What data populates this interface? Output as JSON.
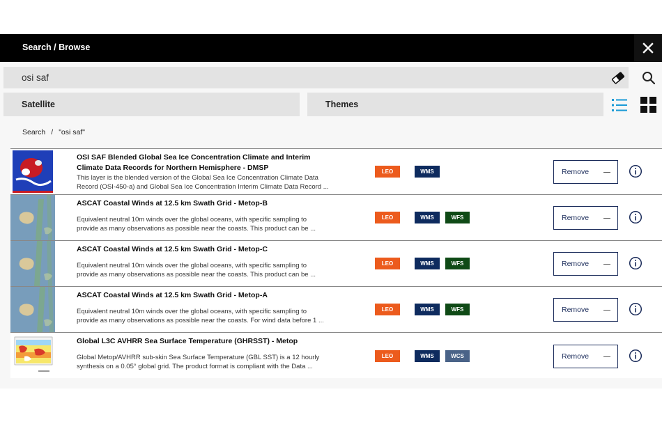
{
  "header": {
    "title": "Search / Browse",
    "close_icon": "close-icon"
  },
  "search": {
    "value": "osi saf",
    "placeholder": "",
    "clear_icon": "eraser-icon",
    "search_icon": "search-icon"
  },
  "tabs": [
    {
      "label": "Satellite"
    },
    {
      "label": "Themes"
    }
  ],
  "view_toggle": {
    "list_icon": "list-view-icon",
    "grid_icon": "grid-view-icon",
    "active": "list",
    "active_color": "#1a9ad6"
  },
  "breadcrumb": {
    "root": "Search",
    "separator": "/",
    "query": "\"osi saf\""
  },
  "results": [
    {
      "title_line1": "OSI SAF Blended Global Sea Ice Concentration Climate and Interim",
      "title_line2": "Climate Data Records for Northern Hemisphere - DMSP",
      "desc_line1": "This layer is the blended version of the Global Sea Ice Concentration Climate Data",
      "desc_line2": "Record (OSI-450-a) and Global Sea Ice Concentration Interim Climate Data Record ...",
      "badges": [
        "LEO",
        "WMS"
      ],
      "remove_label": "Remove",
      "thumb": "sea-ice"
    },
    {
      "title_line1": "ASCAT Coastal Winds at 12.5 km Swath Grid - Metop-B",
      "title_line2": "",
      "desc_line1": "Equivalent neutral 10m winds over the global oceans, with specific sampling to",
      "desc_line2": "provide as many observations as possible near the coasts. This product can be ...",
      "badges": [
        "LEO",
        "WMS",
        "WFS"
      ],
      "remove_label": "Remove",
      "thumb": "winds"
    },
    {
      "title_line1": "ASCAT Coastal Winds at 12.5 km Swath Grid - Metop-C",
      "title_line2": "",
      "desc_line1": "Equivalent neutral 10m winds over the global oceans, with specific sampling to",
      "desc_line2": "provide as many observations as possible near the coasts. This product can be ...",
      "badges": [
        "LEO",
        "WMS",
        "WFS"
      ],
      "remove_label": "Remove",
      "thumb": "winds"
    },
    {
      "title_line1": "ASCAT Coastal Winds at 12.5 km Swath Grid - Metop-A",
      "title_line2": "",
      "desc_line1": "Equivalent neutral 10m winds over the global oceans, with specific sampling to",
      "desc_line2": "provide as many observations as possible near the coasts. For wind data before 1 ...",
      "badges": [
        "LEO",
        "WMS",
        "WFS"
      ],
      "remove_label": "Remove",
      "thumb": "winds"
    },
    {
      "title_line1": "Global L3C AVHRR Sea Surface Temperature (GHRSST) - Metop",
      "title_line2": "",
      "desc_line1": "Global Metop/AVHRR sub-skin Sea Surface Temperature (GBL SST) is a 12 hourly",
      "desc_line2": "synthesis on a 0.05° global grid. The product format is compliant with the Data ...",
      "badges": [
        "LEO",
        "WMS",
        "WCS"
      ],
      "remove_label": "Remove",
      "thumb": "sst"
    }
  ],
  "colors": {
    "leo": "#ec5b1d",
    "wms": "#0e2b5e",
    "wfs": "#0f4a16",
    "wcs": "#4a6388",
    "header_bg": "#000000"
  }
}
